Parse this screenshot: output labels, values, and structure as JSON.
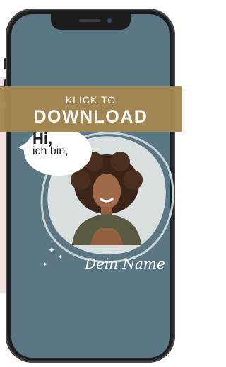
{
  "banner": {
    "subtitle": "KLICK TO",
    "title": "DOWNLOAD"
  },
  "bubble": {
    "greeting": "Hi,",
    "text": "ich bin,"
  },
  "signature": "Dein Name",
  "colors": {
    "screen": "#5b7783",
    "banner": "#a4874f",
    "phone": "#1d1d1f",
    "blob": "#d9dedf"
  }
}
